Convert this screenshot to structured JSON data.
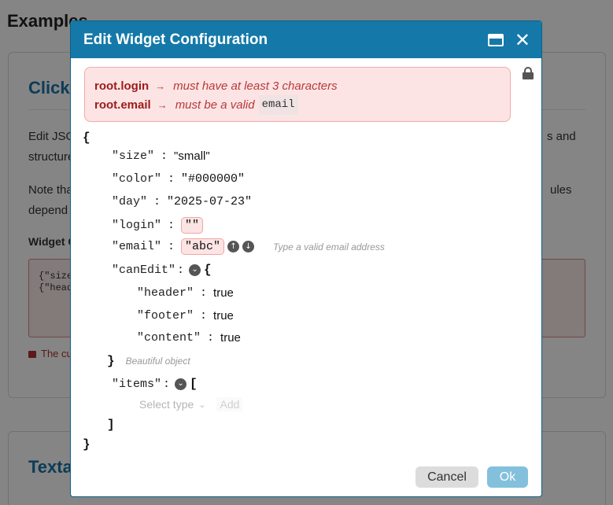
{
  "background": {
    "heading": "Examples",
    "card_title": "Clicka",
    "text_line1_left": "Edit JSO",
    "text_line1_right": "s and",
    "text_line2_left": "structure",
    "text_line3_left": "Note tha",
    "text_line3_right": "ules",
    "text_line4_left": "depend",
    "widget_label": "Widget C",
    "textarea_line1": "{\"size",
    "textarea_line2": "{\"head",
    "note": "The cu",
    "card2_title": "Texta"
  },
  "modal": {
    "title": "Edit Widget Configuration",
    "errors": [
      {
        "path": "root.login",
        "message": "must have at least 3 characters",
        "code": ""
      },
      {
        "path": "root.email",
        "message": "must be a valid",
        "code": "email"
      }
    ],
    "arrow": "→",
    "json": {
      "open_brace": "{",
      "close_brace": "}",
      "size_key": "\"size\"",
      "size_value": "\"small\"",
      "color_key": "\"color\"",
      "color_value": "\"#000000\"",
      "day_key": "\"day\"",
      "day_value": "\"2025-07-23\"",
      "login_key": "\"login\"",
      "login_value": "\"\"",
      "email_key": "\"email\"",
      "email_value": "\"abc\"",
      "email_hint": "Type a valid email address",
      "canEdit_key": "\"canEdit\"",
      "canEdit_open": "{",
      "header_key": "\"header\"",
      "header_value": "true",
      "footer_key": "\"footer\"",
      "footer_value": "true",
      "content_key": "\"content\"",
      "content_value": "true",
      "canEdit_close": "}",
      "canEdit_hint": "Beautiful object",
      "items_key": "\"items\"",
      "items_open": "[",
      "items_close": "]",
      "select_type_placeholder": "Select type",
      "add_label": "Add"
    },
    "cancel_label": "Cancel",
    "ok_label": "Ok"
  }
}
